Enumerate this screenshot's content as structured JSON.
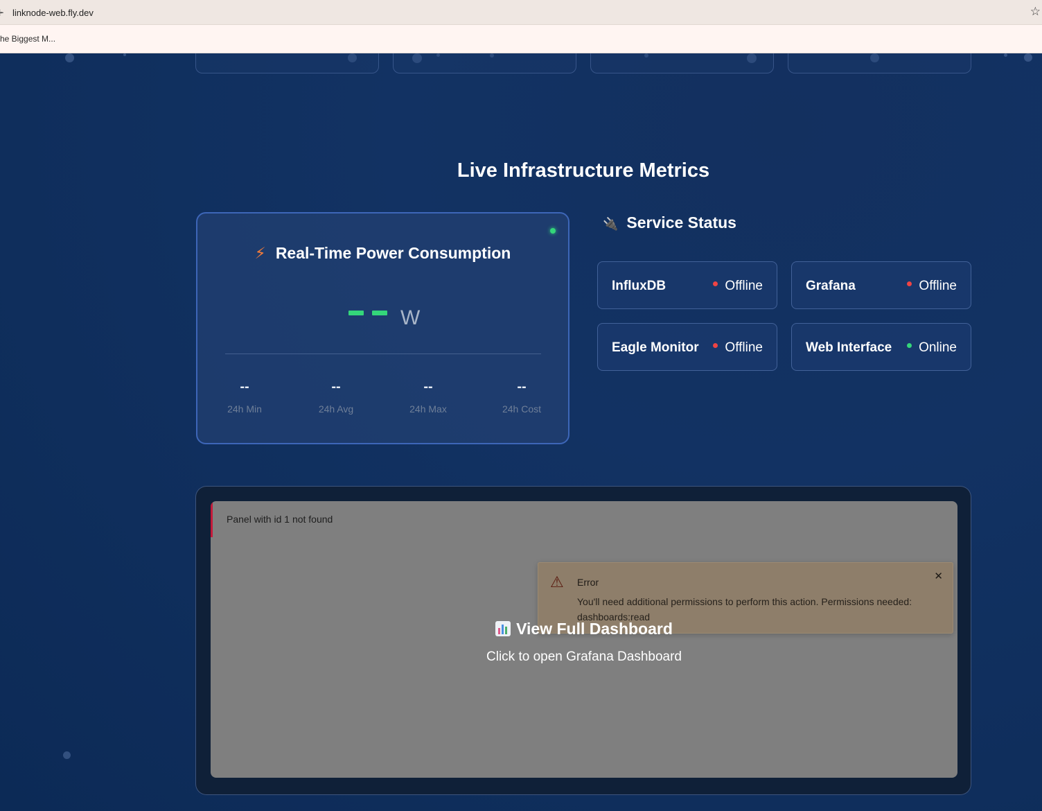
{
  "browser": {
    "url": "linknode-web.fly.dev",
    "bookmark": "he Biggest M..."
  },
  "section": {
    "title": "Live Infrastructure Metrics"
  },
  "power": {
    "title": "Real-Time Power Consumption",
    "unit": "W",
    "stats": [
      {
        "value": "--",
        "label": "24h Min"
      },
      {
        "value": "--",
        "label": "24h Avg"
      },
      {
        "value": "--",
        "label": "24h Max"
      },
      {
        "value": "--",
        "label": "24h Cost"
      }
    ]
  },
  "services": {
    "title": "Service Status",
    "items": [
      {
        "name": "InfluxDB",
        "status": "Offline",
        "color": "#ef4444"
      },
      {
        "name": "Grafana",
        "status": "Offline",
        "color": "#ef4444"
      },
      {
        "name": "Eagle Monitor",
        "status": "Offline",
        "color": "#ef4444"
      },
      {
        "name": "Web Interface",
        "status": "Online",
        "color": "#34d67a"
      }
    ]
  },
  "grafana": {
    "panel_message": "Panel with id 1 not found",
    "error_title": "Error",
    "error_body": "You'll need additional permissions to perform this action. Permissions needed: dashboards:read",
    "link_title": "View Full Dashboard",
    "link_subtitle": "Click to open Grafana Dashboard"
  },
  "colors": {
    "accent_green": "#34d67a",
    "offline_red": "#ef4444",
    "bolt_orange": "#f07b3a"
  }
}
